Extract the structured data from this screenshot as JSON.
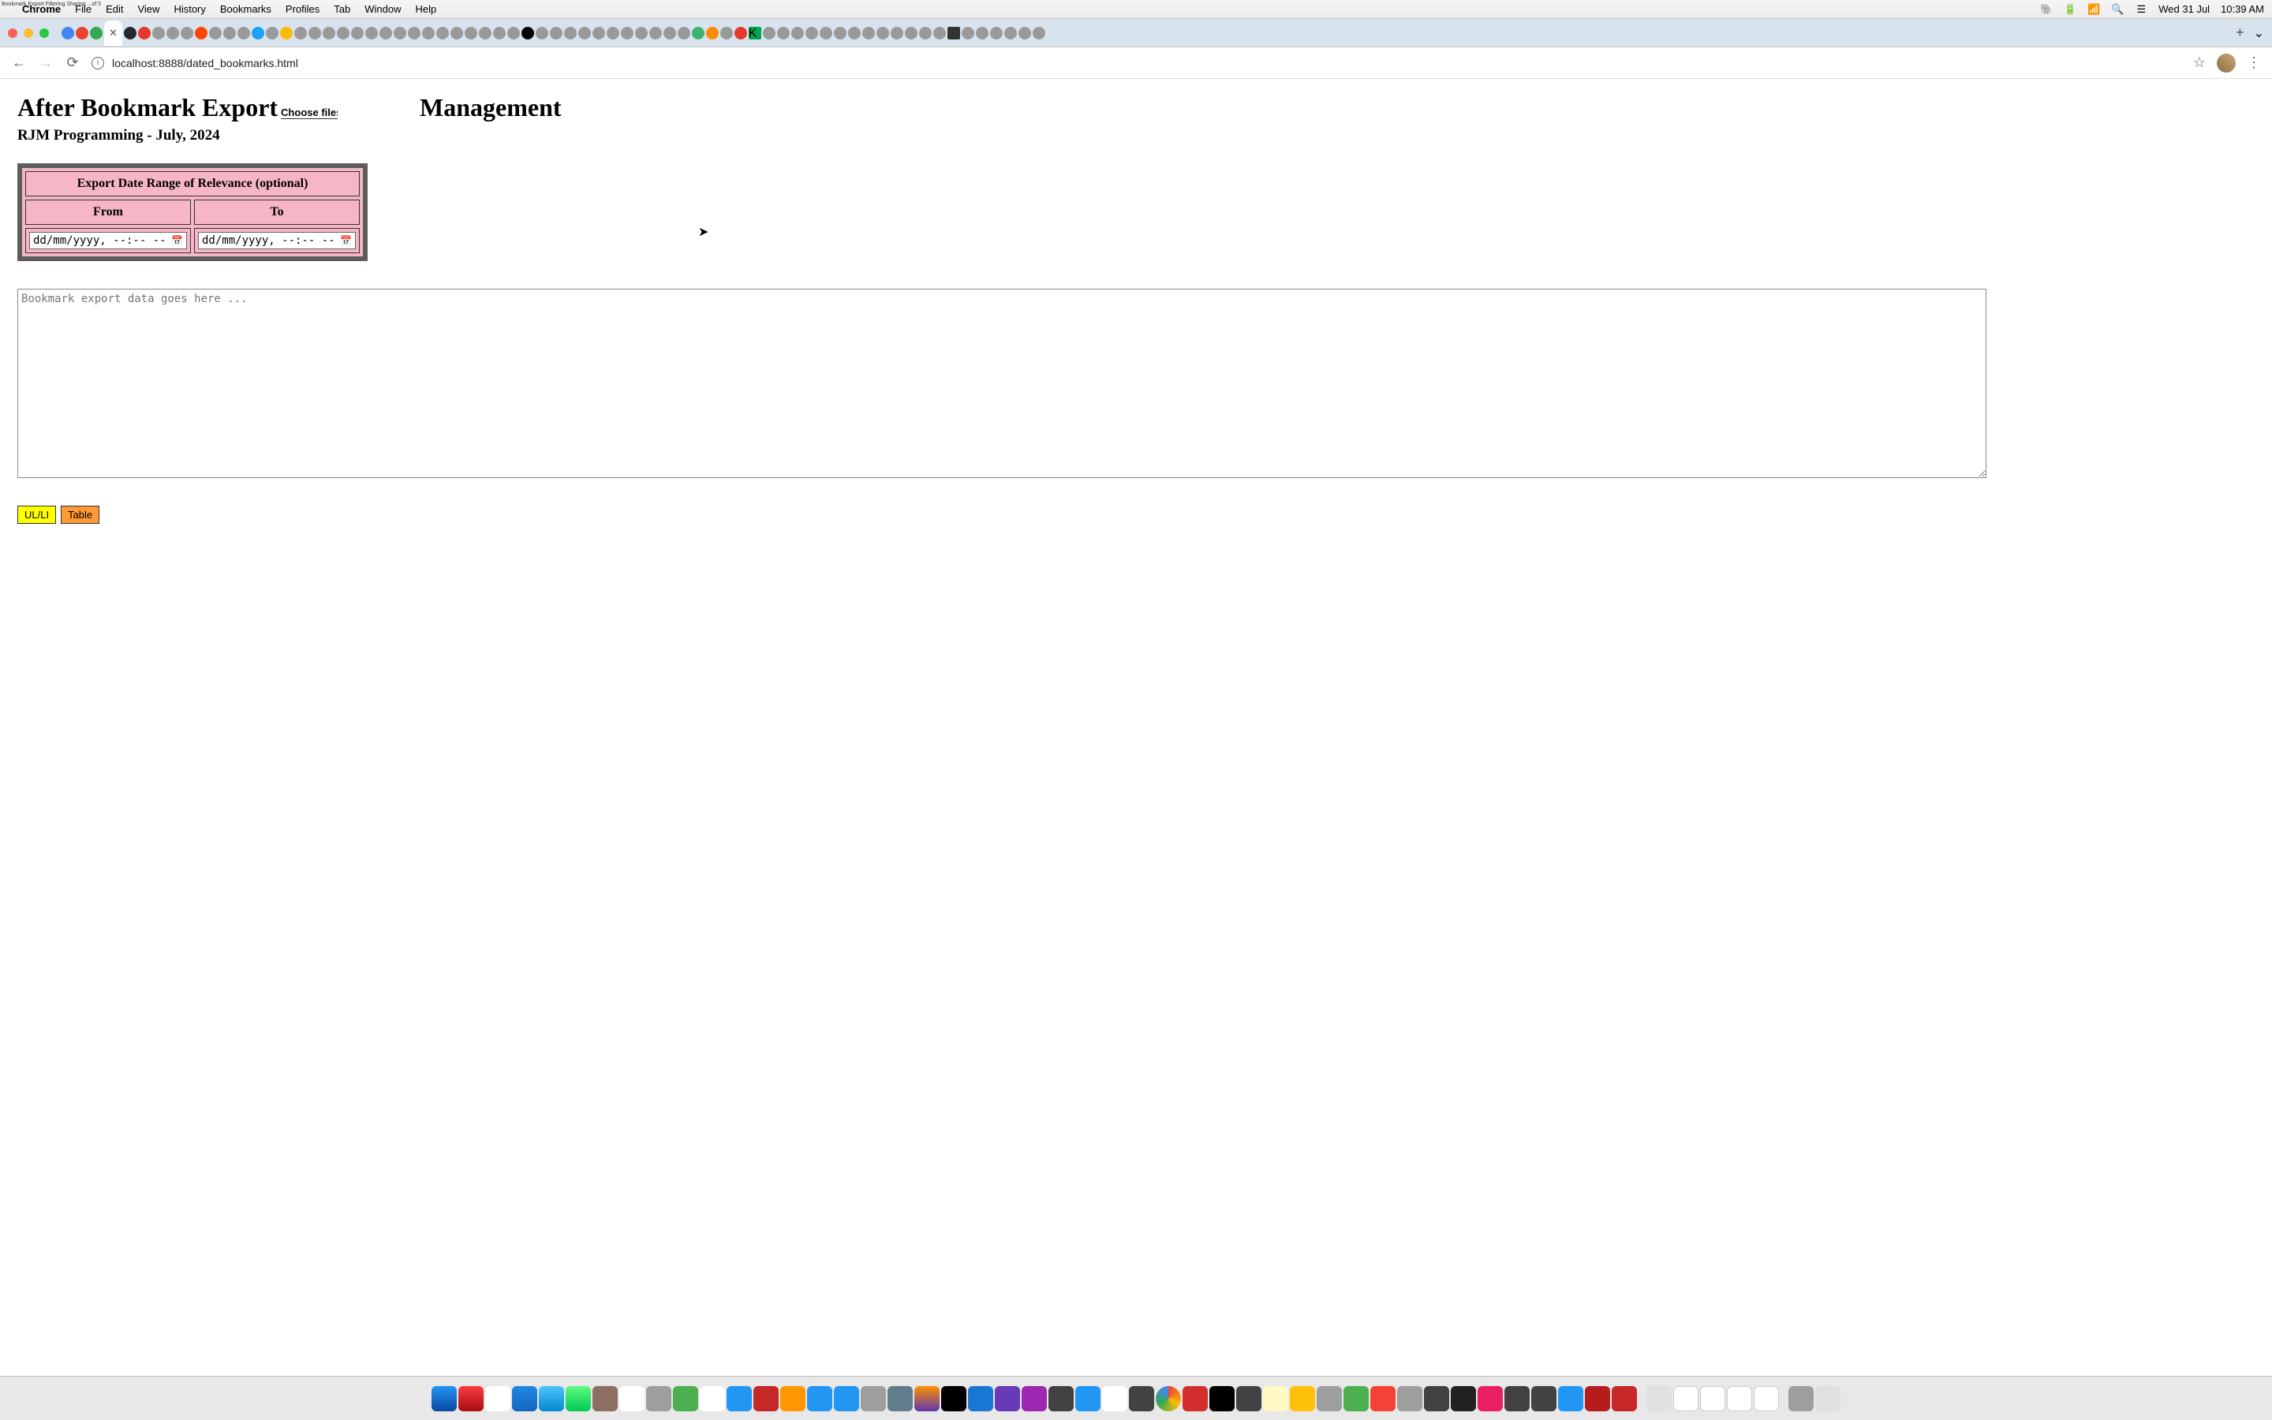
{
  "menubar": {
    "apple": "",
    "appname": "Chrome",
    "items": [
      "File",
      "Edit",
      "View",
      "History",
      "Bookmarks",
      "Profiles",
      "Tab",
      "Window",
      "Help"
    ],
    "date": "Wed 31 Jul",
    "time": "10:39 AM"
  },
  "browser": {
    "url": "localhost:8888/dated_bookmarks.html",
    "active_tab_title": "Bookmark Export Filtering Sharing ..."
  },
  "page": {
    "title_part1": "After Bookmark Export ",
    "file_button_label": "Choose files",
    "title_part2": " Management",
    "subtitle": "RJM Programming - July, 2024",
    "table_caption": "Export Date Range of Relevance (optional)",
    "col_from": "From",
    "col_to": "To",
    "date_placeholder": "dd/mm/yyyy, --:-- --",
    "textarea_placeholder": "Bookmark export data goes here ...",
    "btn_ulli": "UL/LI",
    "btn_table": "Table"
  },
  "tiny_overlay": "Bookmark Export Filtering Sharing ...of 5"
}
